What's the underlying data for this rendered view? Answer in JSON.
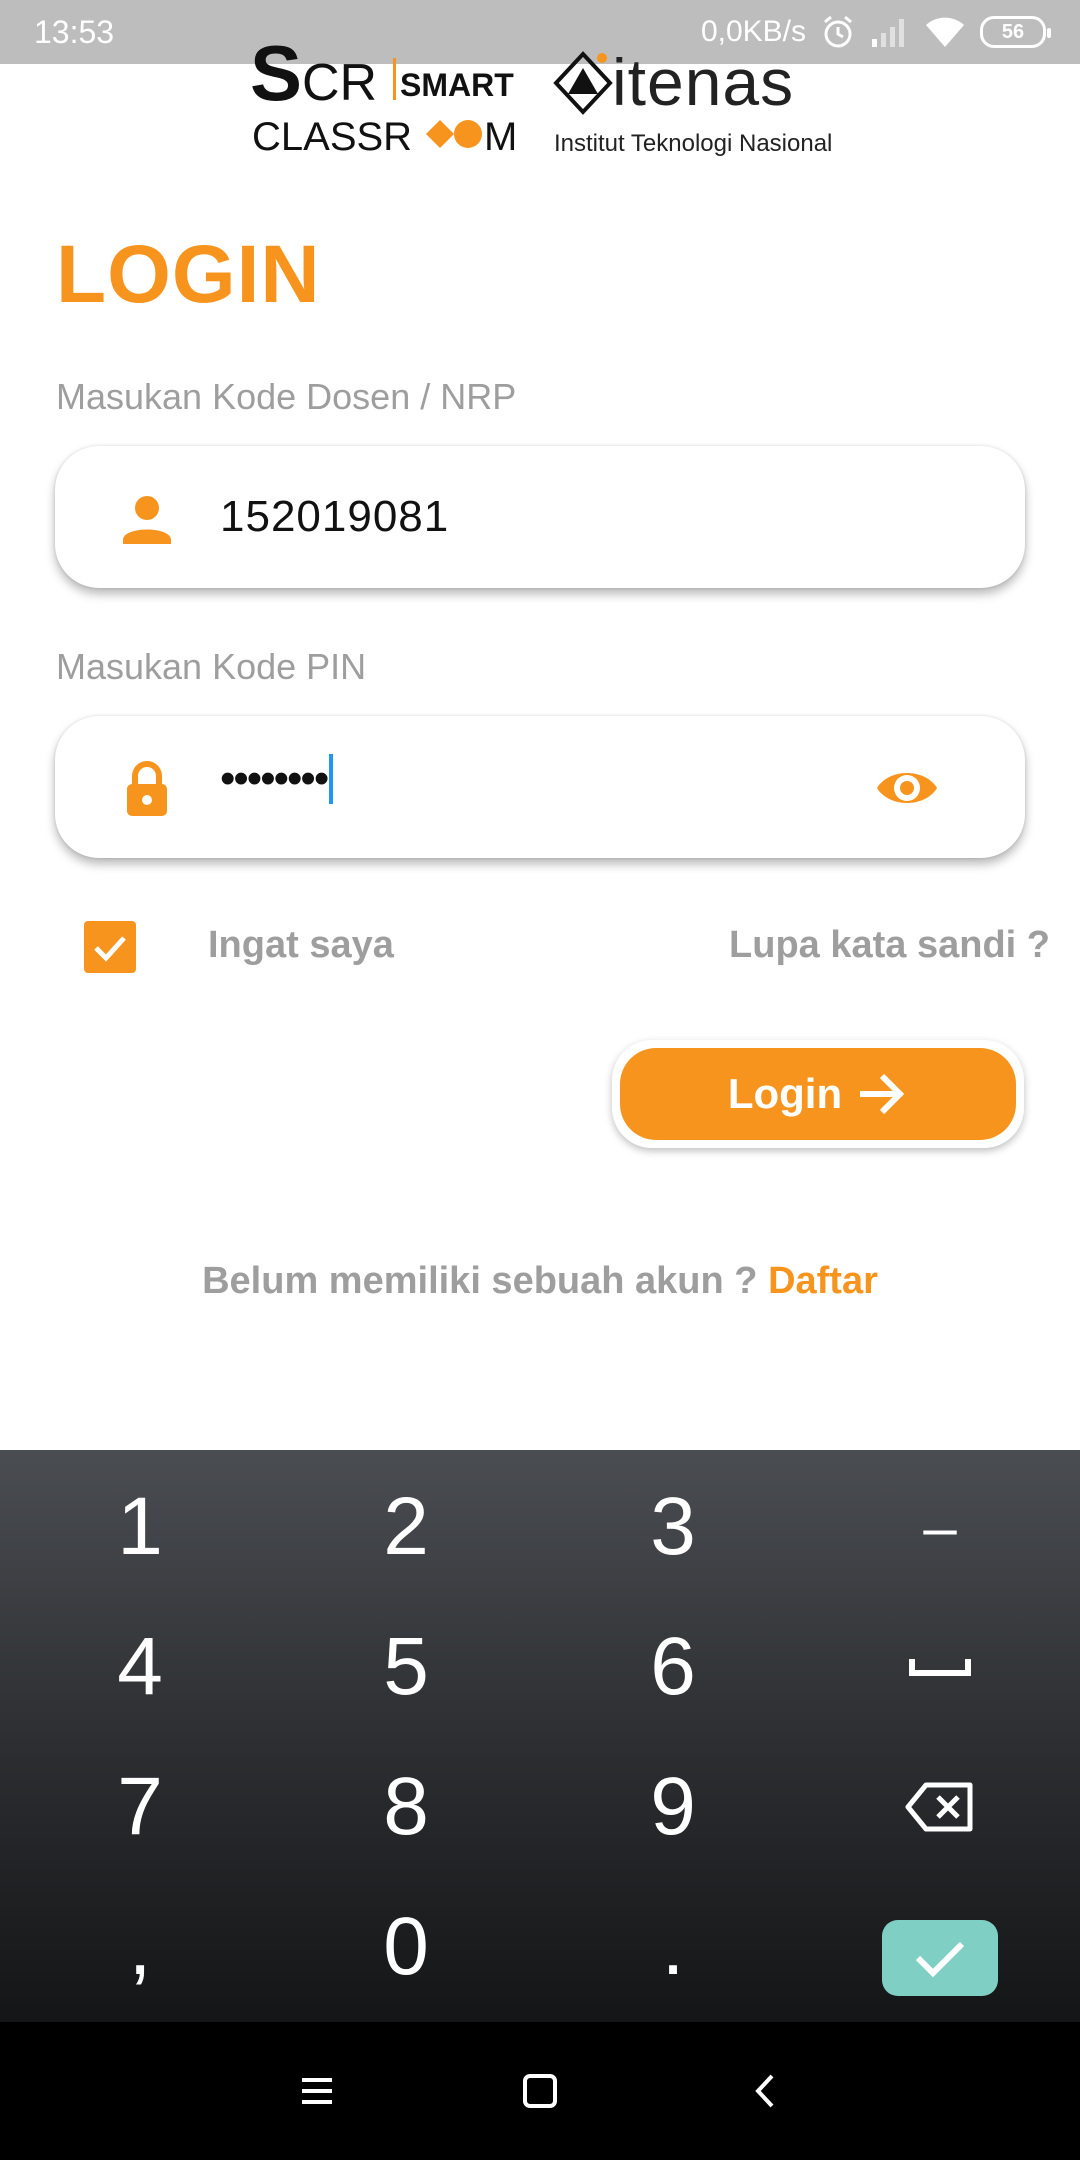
{
  "status_bar": {
    "time": "13:53",
    "net_speed": "0,0KB/s",
    "battery": "56"
  },
  "logos": {
    "scr_line1_s": "S",
    "scr_line1_cr": "CR",
    "scr_smart": "SMART",
    "scr_line2": "CLASSR",
    "scr_line2_end": "M",
    "itenas_name": "itenas",
    "itenas_subtitle": "Institut Teknologi Nasional"
  },
  "login": {
    "title": "LOGIN",
    "user_label": "Masukan Kode Dosen / NRP",
    "user_value": "152019081",
    "pin_label": "Masukan Kode PIN",
    "pin_value": "••••••••",
    "remember_label": "Ingat saya",
    "remember_checked": true,
    "forgot_label": "Lupa kata sandi ?",
    "login_button": "Login",
    "signup_prompt": "Belum memiliki sebuah akun ?",
    "signup_link": "Daftar"
  },
  "keyboard": {
    "keys": [
      "1",
      "2",
      "3",
      "–",
      "4",
      "5",
      "6",
      "␣",
      "7",
      "8",
      "9",
      "⌫",
      ",",
      "0",
      ".",
      "✓"
    ]
  },
  "colors": {
    "accent": "#f7941d",
    "muted": "#9e9e9e",
    "confirm": "#7fcfc4"
  },
  "icons": {
    "user": "person-icon",
    "pin": "lock-icon",
    "visibility": "eye-icon",
    "login_arrow": "arrow-right-icon",
    "checkbox": "check-icon"
  }
}
